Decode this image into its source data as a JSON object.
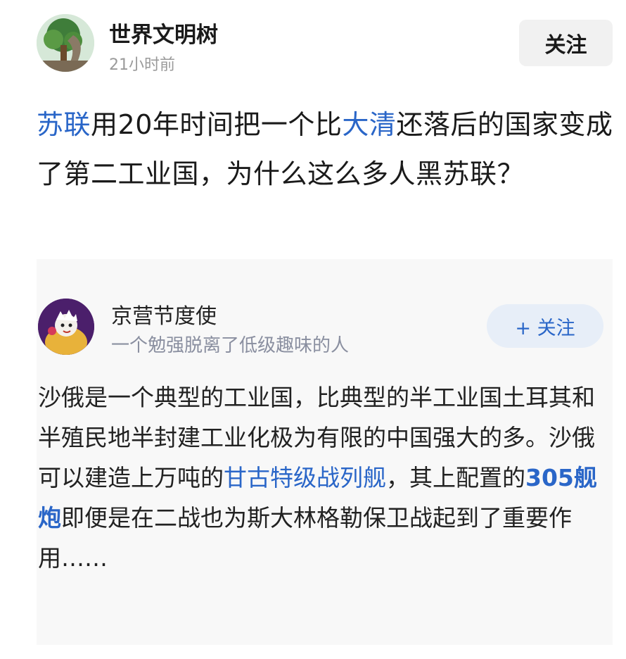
{
  "post": {
    "author": "世界文明树",
    "time": "21小时前",
    "follow_label": "关注",
    "avatar_icon": "tree-avatar-icon"
  },
  "title": {
    "seg1": "苏联",
    "seg2": "用20年时间把一个比",
    "seg3": "大清",
    "seg4": "还落后的国家变成了第二工业国，为什么这么多人黑苏联？"
  },
  "answer": {
    "author": "京营节度使",
    "bio": "一个勉强脱离了低级趣味的人",
    "follow_label": "+ 关注",
    "avatar_icon": "cartoon-avatar-icon",
    "seg1": "沙俄是一个典型的工业国，比典型的半工业国土耳其和半殖民地半封建工业化极为有限的中国强大的多。沙俄可以建造上万吨的",
    "link1": "甘古特级战列舰",
    "seg2": "，其上配置的",
    "link2": "305舰炮",
    "seg3": "即便是在二战也为斯大林格勒保卫战起到了重要作用……"
  },
  "colors": {
    "link": "#2a66c8",
    "text": "#222222",
    "muted": "#9a9a9a",
    "follow_bg": "#e7eef8"
  }
}
